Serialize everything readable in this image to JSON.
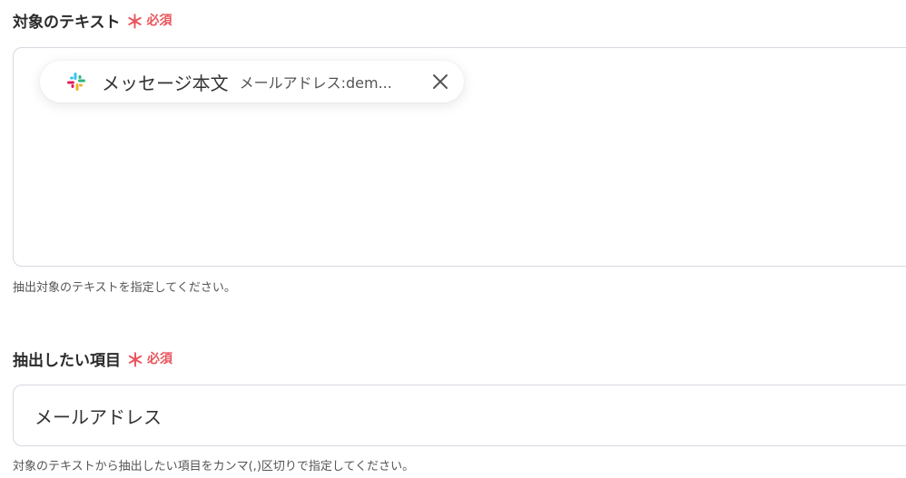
{
  "field1": {
    "label": "対象のテキスト",
    "required_mark": "＊",
    "required_text": "必須",
    "chip": {
      "icon": "slack-icon",
      "title": "メッセージ本文",
      "subtitle": "メールアドレス:dem..."
    },
    "help": "抽出対象のテキストを指定してください。"
  },
  "field2": {
    "label": "抽出したい項目",
    "required_mark": "＊",
    "required_text": "必須",
    "value": "メールアドレス",
    "help": "対象のテキストから抽出したい項目をカンマ(,)区切りで指定してください。"
  },
  "colors": {
    "required": "#e8555b",
    "border": "#d5d8df",
    "text": "#2b2b2b"
  }
}
